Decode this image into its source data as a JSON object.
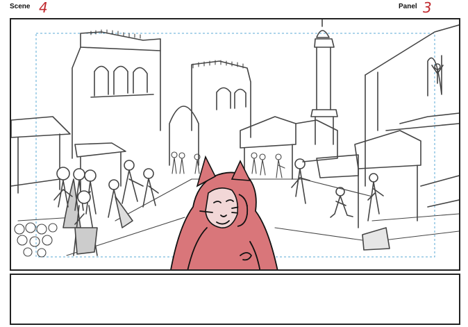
{
  "header": {
    "scene_label": "Scene",
    "scene_number": "4",
    "panel_label": "Panel",
    "panel_number": "3"
  },
  "notes": {
    "text": ""
  },
  "colors": {
    "number_red": "#c0282d",
    "cloak_red": "#d9767a",
    "safe_area_guide": "#5aa9d6",
    "frame_border": "#222222",
    "sketch_line": "#444444"
  }
}
